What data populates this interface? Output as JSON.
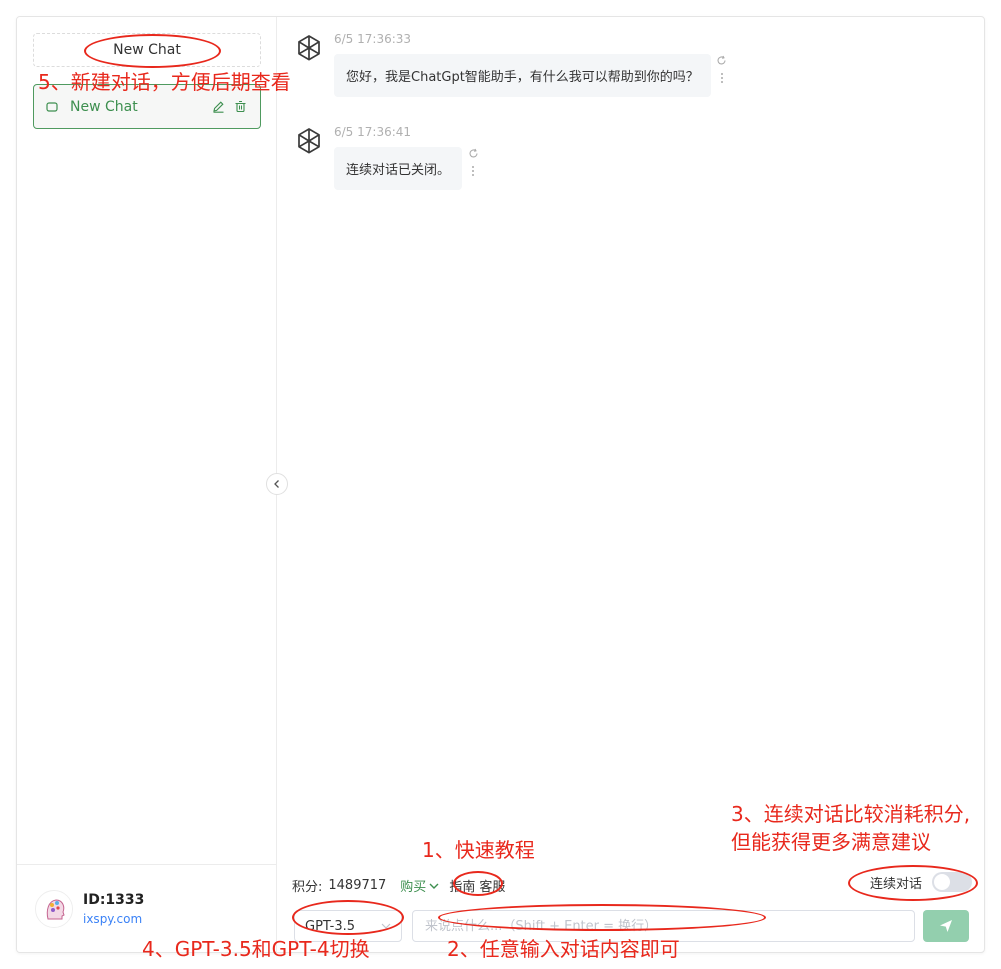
{
  "sidebar": {
    "new_chat_label": "New Chat",
    "items": [
      {
        "title": "New Chat"
      }
    ],
    "user": {
      "id": "ID:1333",
      "site": "ixspy.com"
    }
  },
  "messages": [
    {
      "time": "6/5 17:36:33",
      "text": "您好，我是ChatGpt智能助手，有什么我可以帮助到你的吗？"
    },
    {
      "time": "6/5 17:36:41",
      "text": "连续对话已关闭。"
    }
  ],
  "footer": {
    "score_label": "积分:",
    "score_value": "1489717",
    "buy_label": "购买",
    "guide_label": "指南",
    "service_label": "客服",
    "continuous_label": "连续对话",
    "continuous_on": false,
    "model_value": "GPT-3.5",
    "input_placeholder": "来说点什么...（Shift + Enter = 换行）"
  },
  "annotations": {
    "a1": "1、快速教程",
    "a2": "2、任意输入对话内容即可",
    "a3_line1": "3、连续对话比较消耗积分,",
    "a3_line2": "但能获得更多满意建议",
    "a4": "4、GPT-3.5和GPT-4切换",
    "a5": "5、新建对话，方便后期查看"
  },
  "colors": {
    "accent": "#3d8f4f",
    "annotation": "#e8281c",
    "send_button": "#93cfae"
  }
}
